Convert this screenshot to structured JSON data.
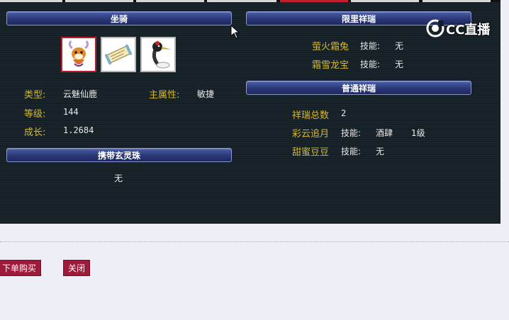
{
  "tabs": [
    {
      "active": false
    },
    {
      "active": false
    },
    {
      "active": false
    },
    {
      "active": false
    },
    {
      "active": true
    },
    {
      "active": false
    },
    {
      "active": false
    }
  ],
  "mount": {
    "section_title": "坐骑",
    "pets": [
      {
        "icon": "deer-mount-icon",
        "selected": true
      },
      {
        "icon": "scroll-icon",
        "selected": false
      },
      {
        "icon": "crane-icon",
        "selected": false
      }
    ],
    "type_label": "类型:",
    "type_value": "云魅仙鹿",
    "main_attr_label": "主属性:",
    "main_attr_value": "敏捷",
    "level_label": "等级:",
    "level_value": "144",
    "growth_label": "成长:",
    "growth_value": "1.2684"
  },
  "orb": {
    "section_title": "携带玄灵珠",
    "value": "无"
  },
  "limited": {
    "section_title": "限里祥瑞",
    "items": [
      {
        "name": "萤火霜兔",
        "skill_label": "技能:",
        "skill_value": "无"
      },
      {
        "name": "霜雪龙宝",
        "skill_label": "技能:",
        "skill_value": "无"
      }
    ]
  },
  "normal": {
    "section_title": "普通祥瑞",
    "total_label": "祥瑞总数",
    "total_value": "2",
    "items": [
      {
        "name": "彩云追月",
        "skill_label": "技能:",
        "skill_value": "酒肆",
        "skill_level": "1级"
      },
      {
        "name": "甜蜜豆豆",
        "skill_label": "技能:",
        "skill_value": "无",
        "skill_level": ""
      }
    ]
  },
  "actions": {
    "buy_label": "下单购买",
    "close_label": "关闭"
  },
  "watermark": {
    "text": "CC直播",
    "icon": "cc-logo-icon"
  },
  "colors": {
    "panel_bg": "#152026",
    "label_gold": "#d4b832",
    "section_bar": "#2a3876",
    "button_bg": "#9e1a3a",
    "page_bg": "#eeeef6"
  }
}
